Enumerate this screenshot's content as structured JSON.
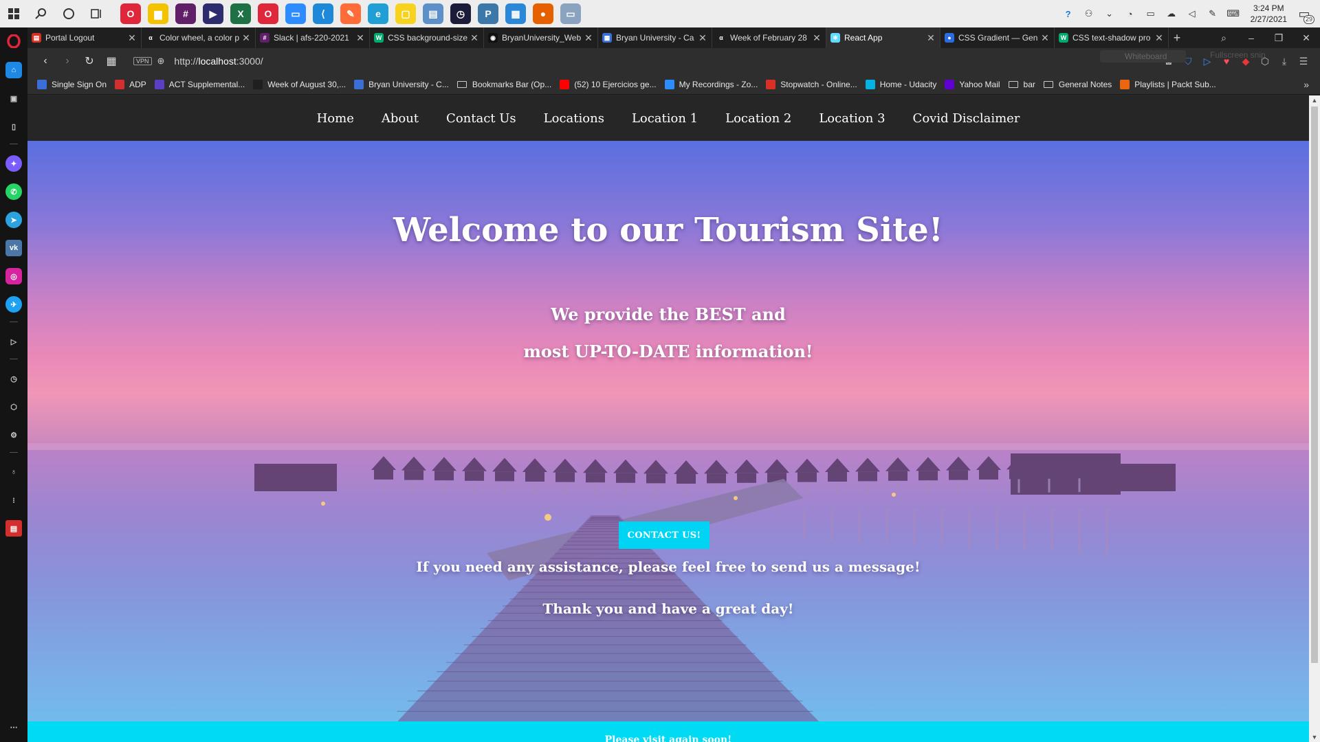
{
  "taskbar": {
    "apps": [
      {
        "name": "opera-gx-app-icon",
        "color": "#e0263a",
        "glyph": "O"
      },
      {
        "name": "file-explorer-app-icon",
        "color": "#f3c300",
        "glyph": "▆"
      },
      {
        "name": "slack-app-icon",
        "color": "#611f69",
        "glyph": "#"
      },
      {
        "name": "power-automate-app-icon",
        "color": "#2c2c6e",
        "glyph": "▶"
      },
      {
        "name": "excel-app-icon",
        "color": "#1e7145",
        "glyph": "X"
      },
      {
        "name": "opera-app-icon",
        "color": "#e0263a",
        "glyph": "O"
      },
      {
        "name": "zoom-app-icon",
        "color": "#2d8cff",
        "glyph": "▭"
      },
      {
        "name": "vscode-app-icon",
        "color": "#1e88d9",
        "glyph": "⟨"
      },
      {
        "name": "postman-app-icon",
        "color": "#ff6c37",
        "glyph": "✎"
      },
      {
        "name": "edge-app-icon",
        "color": "#1f9fd6",
        "glyph": "e"
      },
      {
        "name": "sticky-notes-app-icon",
        "color": "#f7d21e",
        "glyph": "▢"
      },
      {
        "name": "control-panel-app-icon",
        "color": "#5d8fc9",
        "glyph": "▤"
      },
      {
        "name": "stopwatch-app-icon",
        "color": "#1b1b3a",
        "glyph": "◷"
      },
      {
        "name": "python-app-icon",
        "color": "#3b77a8",
        "glyph": "P"
      },
      {
        "name": "ms-store-app-icon",
        "color": "#2b88d8",
        "glyph": "▦"
      },
      {
        "name": "firefox-app-icon",
        "color": "#e66000",
        "glyph": "●"
      },
      {
        "name": "computer-app-icon",
        "color": "#8aa3c0",
        "glyph": "▭"
      }
    ],
    "clock_time": "3:24 PM",
    "clock_date": "2/27/2021",
    "notification_count": "29"
  },
  "tabs": [
    {
      "title": "Portal Logout",
      "fav_color": "#d93025",
      "fav_glyph": "▤",
      "active": false
    },
    {
      "title": "Color wheel, a color p",
      "fav_color": "#1f1f1f",
      "fav_glyph": "α",
      "active": false
    },
    {
      "title": "Slack | afs-220-2021",
      "fav_color": "#611f69",
      "fav_glyph": "#",
      "active": false
    },
    {
      "title": "CSS background-size",
      "fav_color": "#04aa6d",
      "fav_glyph": "W",
      "active": false
    },
    {
      "title": "BryanUniversity_Web",
      "fav_color": "#111111",
      "fav_glyph": "◉",
      "active": false
    },
    {
      "title": "Bryan University - Ca",
      "fav_color": "#3a6fd8",
      "fav_glyph": "▦",
      "active": false
    },
    {
      "title": "Week of February 28",
      "fav_color": "#1f1f1f",
      "fav_glyph": "α",
      "active": false
    },
    {
      "title": "React App",
      "fav_color": "#61dafb",
      "fav_glyph": "⚛",
      "active": true
    },
    {
      "title": "CSS Gradient — Gen",
      "fav_color": "#2d6cdf",
      "fav_glyph": "●",
      "active": false
    },
    {
      "title": "CSS text-shadow pro",
      "fav_color": "#04aa6d",
      "fav_glyph": "W",
      "active": false
    }
  ],
  "address": {
    "url_prefix": "http://",
    "url_host": "localhost",
    "url_suffix": ":3000/",
    "vpn_label": "VPN",
    "whiteboard_hint": "Whiteboard",
    "fullscreen_hint": "Fullscreen snip"
  },
  "bookmarks": [
    {
      "label": "Single Sign On",
      "kind": "icon",
      "color": "#3a6fd8"
    },
    {
      "label": "ADP",
      "kind": "icon",
      "color": "#d32f2f"
    },
    {
      "label": "ACT Supplemental...",
      "kind": "icon",
      "color": "#5b3fc4"
    },
    {
      "label": "Week of August 30,...",
      "kind": "icon",
      "color": "#1f1f1f"
    },
    {
      "label": "Bryan University - C...",
      "kind": "icon",
      "color": "#3a6fd8"
    },
    {
      "label": "Bookmarks Bar (Op...",
      "kind": "folder",
      "color": ""
    },
    {
      "label": "(52) 10 Ejercicios ge...",
      "kind": "icon",
      "color": "#ff0000"
    },
    {
      "label": "My Recordings - Zo...",
      "kind": "icon",
      "color": "#2d8cff"
    },
    {
      "label": "Stopwatch - Online...",
      "kind": "icon",
      "color": "#d93025"
    },
    {
      "label": "Home - Udacity",
      "kind": "icon",
      "color": "#02b3e4"
    },
    {
      "label": "Yahoo Mail",
      "kind": "icon",
      "color": "#6001d2"
    },
    {
      "label": "bar",
      "kind": "folder",
      "color": ""
    },
    {
      "label": "General Notes",
      "kind": "folder",
      "color": ""
    },
    {
      "label": "Playlists | Packt Sub...",
      "kind": "icon",
      "color": "#ec6611"
    }
  ],
  "site": {
    "nav": [
      "Home",
      "About",
      "Contact Us",
      "Locations",
      "Location 1",
      "Location 2",
      "Location 3",
      "Covid Disclaimer"
    ],
    "title": "Welcome to our Tourism Site!",
    "line1": "We provide the BEST and",
    "line2": "most UP-TO-DATE information!",
    "contact_button": "CONTACT US!",
    "assist": "If you need any assistance, please feel free to send us a message!",
    "thanks": "Thank you and have a great day!",
    "footer": "Please visit again soon!"
  }
}
